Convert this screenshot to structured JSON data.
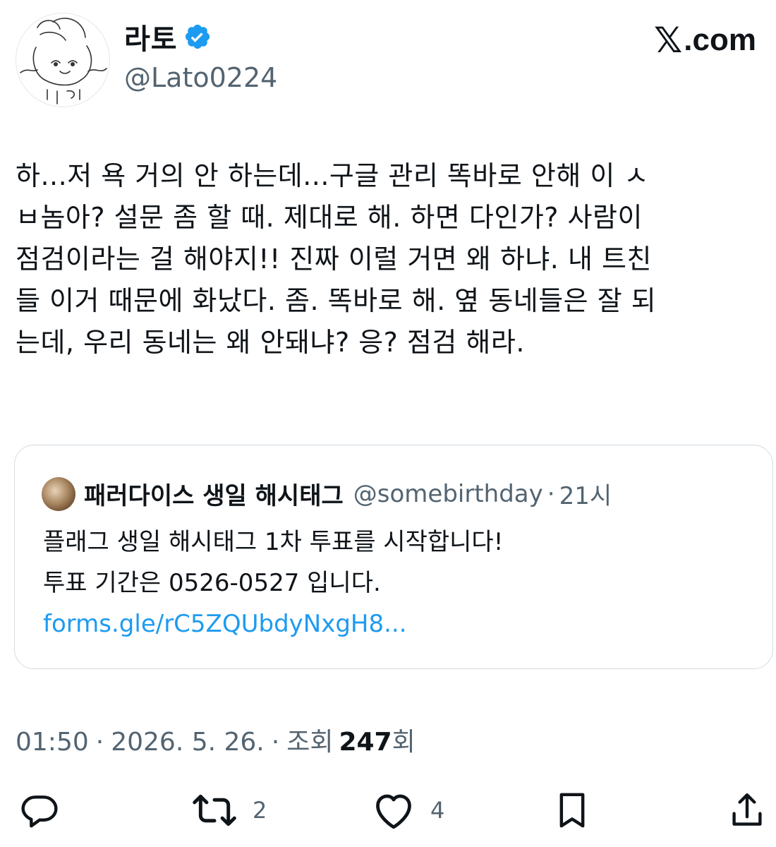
{
  "author": {
    "display_name": "라토",
    "handle": "@Lato0224",
    "verified": true,
    "verified_color": "#1d9bf0"
  },
  "brand": {
    "x_mark": "𝕏",
    "domain": ".com"
  },
  "tweet": {
    "text": "하...저 욕 거의 안 하는데...구글 관리 똑바로 안해 이 ㅅ\nㅂ놈아? 설문 좀 할 때. 제대로 해. 하면 다인가? 사람이\n점검이라는 걸 해야지!! 진짜 이럴 거면 왜 하냐. 내 트친\n들 이거 때문에 화났다. 좀. 똑바로 해. 옆 동네들은 잘 되\n는데, 우리 동네는 왜 안돼냐? 응? 점검 해라."
  },
  "quoted_tweet": {
    "display_name": "패러다이스 생일 해시태그",
    "handle": "@somebirthday",
    "separator": "·",
    "time": "21시",
    "line1": "플래그 생일 해시태그 1차 투표를 시작합니다!",
    "line2": "투표 기간은 0526-0527 입니다.",
    "link": "forms.gle/rC5ZQUbdyNxgH8..."
  },
  "meta": {
    "time": "01:50",
    "sep1": "·",
    "date": "2026. 5. 26.",
    "sep2": "·",
    "views_label": "조회",
    "views_count": "247",
    "views_suffix": "회"
  },
  "actions": {
    "reply_icon": "reply-icon",
    "retweet_icon": "retweet-icon",
    "retweet_count": "2",
    "like_icon": "heart-icon",
    "like_count": "4",
    "bookmark_icon": "bookmark-icon",
    "share_icon": "share-icon"
  },
  "colors": {
    "text": "#0f1419",
    "secondary": "#536471",
    "link": "#1d9bf0",
    "border": "#d5dbe0"
  }
}
